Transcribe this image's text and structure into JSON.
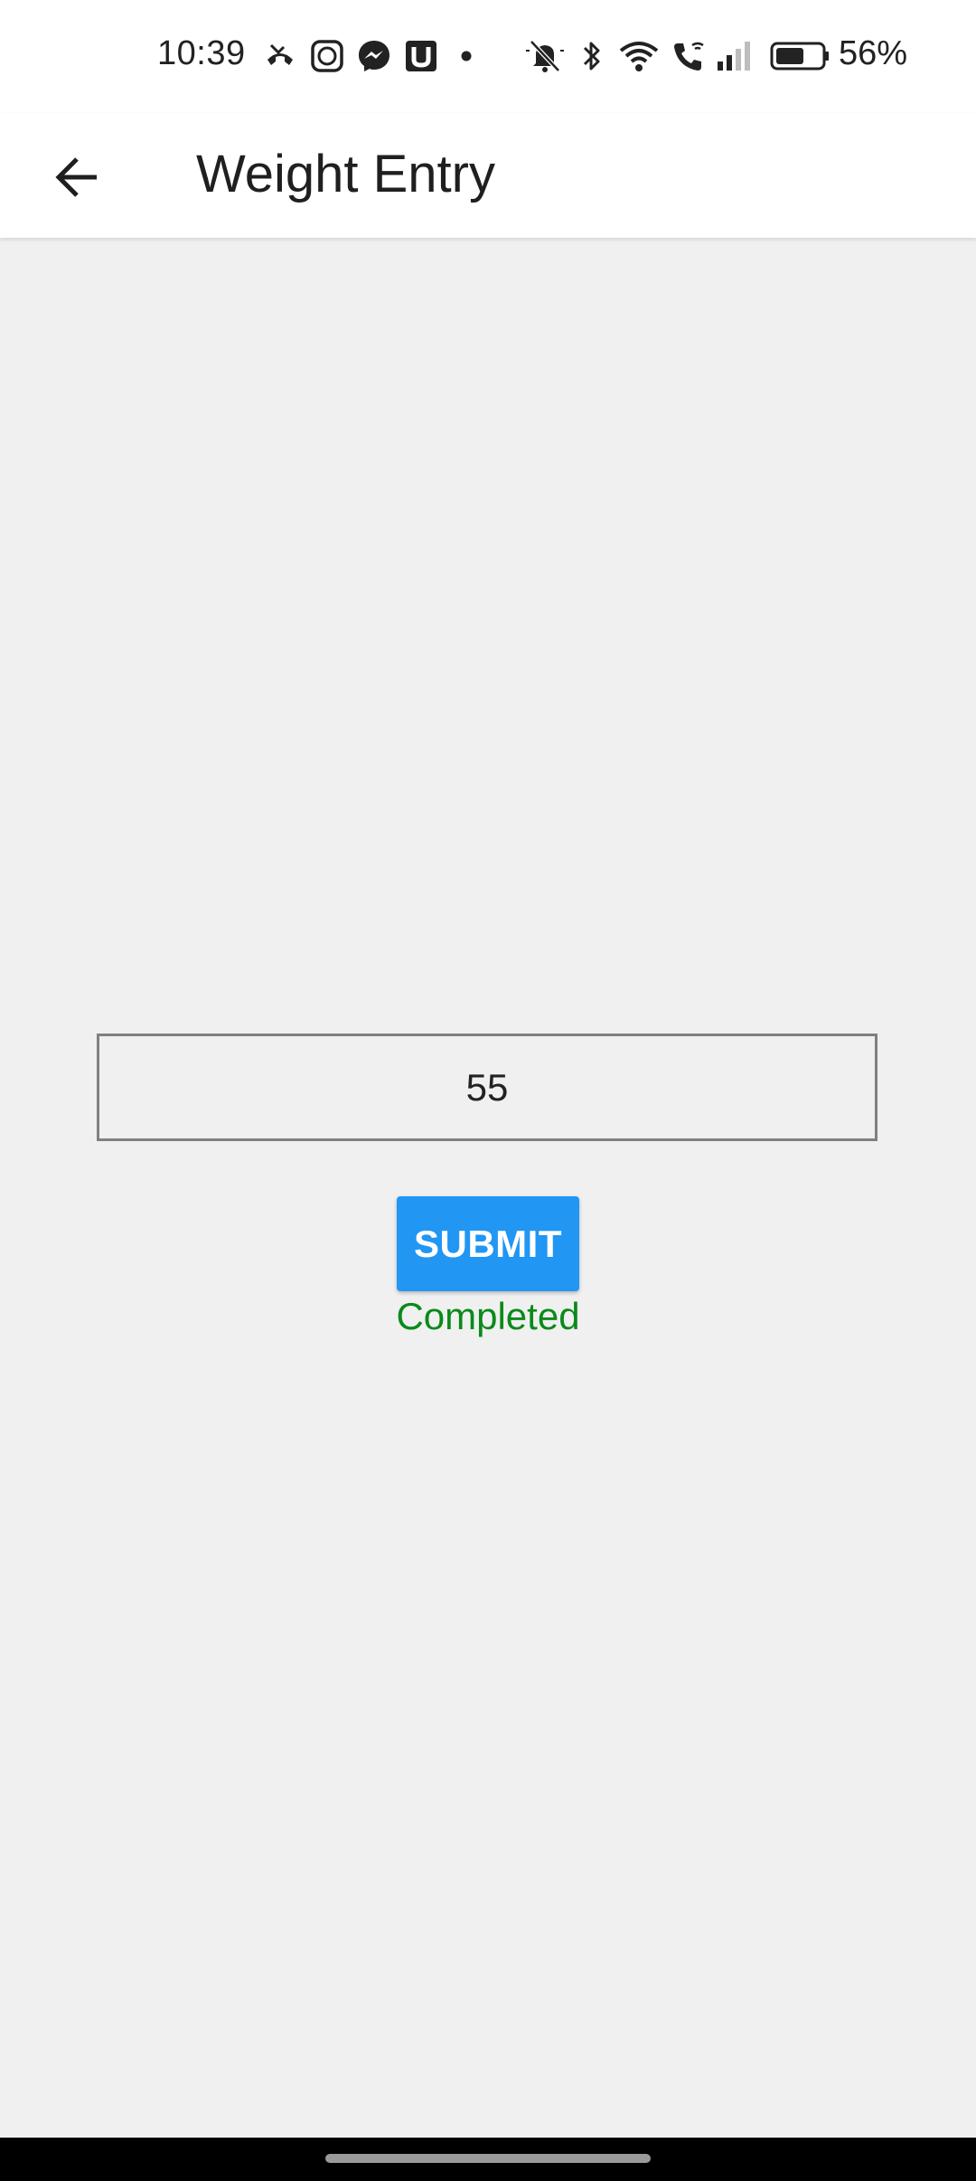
{
  "status_bar": {
    "time": "10:39",
    "battery": "56%",
    "icons": [
      "missed-call-icon",
      "messenger-bubble-icon",
      "messenger-icon",
      "u-app-icon",
      "notification-dot-icon",
      "mute-icon",
      "bluetooth-icon",
      "wifi-icon",
      "wifi-calling-icon",
      "signal-icon",
      "battery-icon"
    ]
  },
  "app_bar": {
    "title": "Weight Entry",
    "back_icon": "arrow-back-icon"
  },
  "form": {
    "weight_value": "55",
    "submit_label": "SUBMIT",
    "status_text": "Completed",
    "status_color": "#0a8a1a",
    "accent_color": "#2196f3"
  }
}
